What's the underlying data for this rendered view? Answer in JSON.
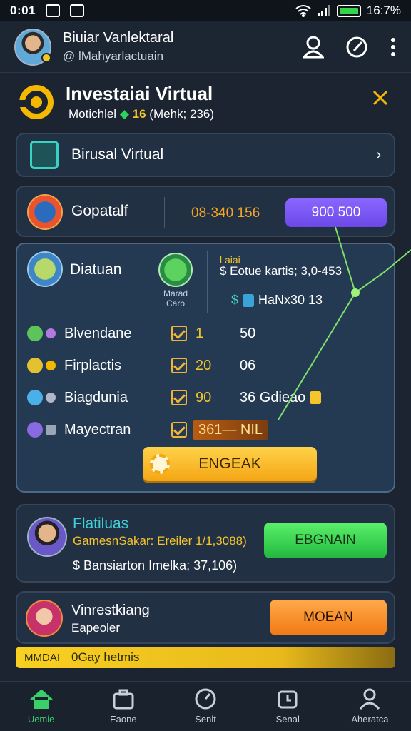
{
  "status": {
    "time": "0:01",
    "battery": "16:7%"
  },
  "header": {
    "name": "Biuiar Vanlektaral",
    "handle": "@ lMahyarlactuain"
  },
  "title": {
    "heading": "Investaiai Virtual",
    "sub_label": "Motichlel",
    "sub_value": "16",
    "sub_extra": "(Mehk; 236)"
  },
  "virtual_row": {
    "label": "Birusal Virtual"
  },
  "capital": {
    "label": "Gopatalf",
    "value": "08-340 156",
    "pill": "900 500"
  },
  "panel": {
    "label": "Diatuan",
    "globe_caption": "Marad Caro",
    "info_top": "l aiai",
    "info_line": "$ Eotue kartis; 3,0-453",
    "info_code": "HaNx30 13",
    "rows": [
      {
        "name": "Blvendane",
        "v1": "1",
        "v2": "50"
      },
      {
        "name": "Firplactis",
        "v1": "20",
        "v2": "06"
      },
      {
        "name": "Biagdunia",
        "v1": "90",
        "v2": "36 Gdieao"
      },
      {
        "name": "Mayectran",
        "v1": "",
        "v2": "361— NIL"
      }
    ],
    "button": "ENGEAK"
  },
  "profile": {
    "title": "Flatiluas",
    "sub": "GamesnSakar: Ereiler 1/1,3088)",
    "detail": "$ Bansiarton Imelka; 37,106)",
    "button": "EBGNAIN"
  },
  "invest": {
    "title": "Vinrestkiang",
    "sub": "Eapeoler",
    "button": "MOEAN"
  },
  "banner": {
    "left": "MMDAI",
    "right": "0Gay hetmis"
  },
  "nav": [
    {
      "label": "Uemie"
    },
    {
      "label": "Eaone"
    },
    {
      "label": "Senlt"
    },
    {
      "label": "Senal"
    },
    {
      "label": "Aheratca"
    }
  ],
  "colors": {
    "accent_green": "#39d06a",
    "accent_yellow": "#f5c52c",
    "accent_purple": "#7a58f2",
    "accent_orange": "#f5a623"
  }
}
